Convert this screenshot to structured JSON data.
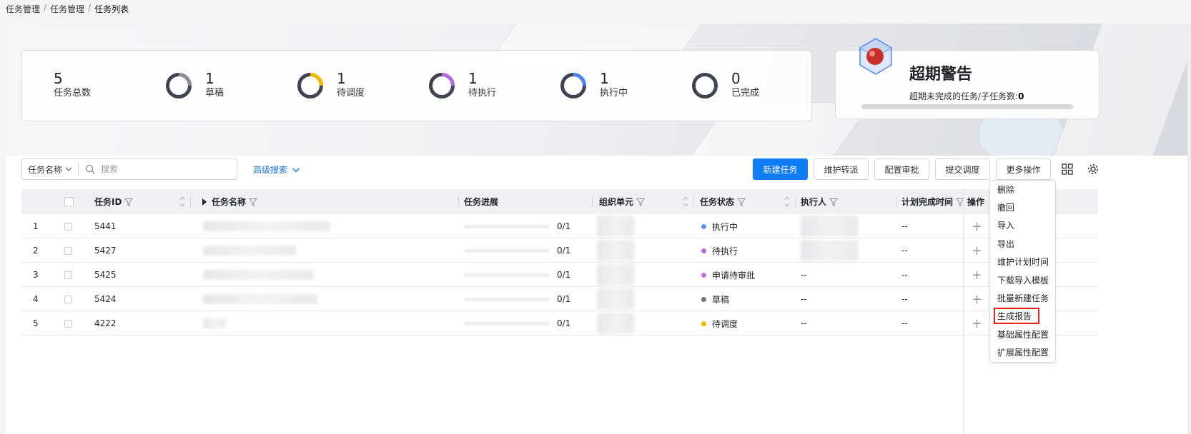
{
  "breadcrumb": [
    "任务管理",
    "任务管理",
    "任务列表"
  ],
  "stats": [
    {
      "value": "5",
      "label": "任务总数"
    },
    {
      "value": "1",
      "label": "草稿",
      "color": "#8a8d93"
    },
    {
      "value": "1",
      "label": "待调度",
      "color": "#f5b800"
    },
    {
      "value": "1",
      "label": "待执行",
      "color": "#b36ae2"
    },
    {
      "value": "1",
      "label": "执行中",
      "color": "#4a86f0"
    },
    {
      "value": "0",
      "label": "已完成"
    }
  ],
  "overdue": {
    "title": "超期警告",
    "subtitle": "超期未完成的任务/子任务数:",
    "count": "0",
    "icon": "crystal-gem-icon"
  },
  "search": {
    "field": "任务名称",
    "placeholder": "搜索",
    "advanced": "高级搜索"
  },
  "toolbar": {
    "new_task": "新建任务",
    "maintain_transfer": "维护转派",
    "config_approval": "配置审批",
    "submit_schedule": "提交调度",
    "more_ops": "更多操作"
  },
  "columns": {
    "id": "任务ID",
    "name": "任务名称",
    "progress": "任务进展",
    "org": "组织单元",
    "status": "任务状态",
    "executor": "执行人",
    "plan_time": "计划完成时间",
    "ops": "操作"
  },
  "rows": [
    {
      "index": "1",
      "id": "5441",
      "progress": "0/1",
      "status": "执行中",
      "status_color": "#5b8ff9",
      "executor": "",
      "plan_time": "--",
      "op": "+"
    },
    {
      "index": "2",
      "id": "5427",
      "progress": "0/1",
      "status": "待执行",
      "status_color": "#b36ae2",
      "executor": "",
      "plan_time": "--",
      "op": "+"
    },
    {
      "index": "3",
      "id": "5425",
      "progress": "0/1",
      "status": "申请待审批",
      "status_color": "#c770e6",
      "executor": "--",
      "plan_time": "--",
      "op": "+"
    },
    {
      "index": "4",
      "id": "5424",
      "progress": "0/1",
      "status": "草稿",
      "status_color": "#6f7278",
      "executor": "--",
      "plan_time": "--",
      "op": "+"
    },
    {
      "index": "5",
      "id": "4222",
      "progress": "0/1",
      "status": "待调度",
      "status_color": "#f5b800",
      "executor": "--",
      "plan_time": "--",
      "op": "+"
    }
  ],
  "more_menu": [
    "删除",
    "撤回",
    "导入",
    "导出",
    "维护计划时间",
    "下载导入模板",
    "批量新建任务",
    "生成报告",
    "基础属性配置",
    "扩展属性配置"
  ],
  "highlighted_menu_item": "生成报告"
}
